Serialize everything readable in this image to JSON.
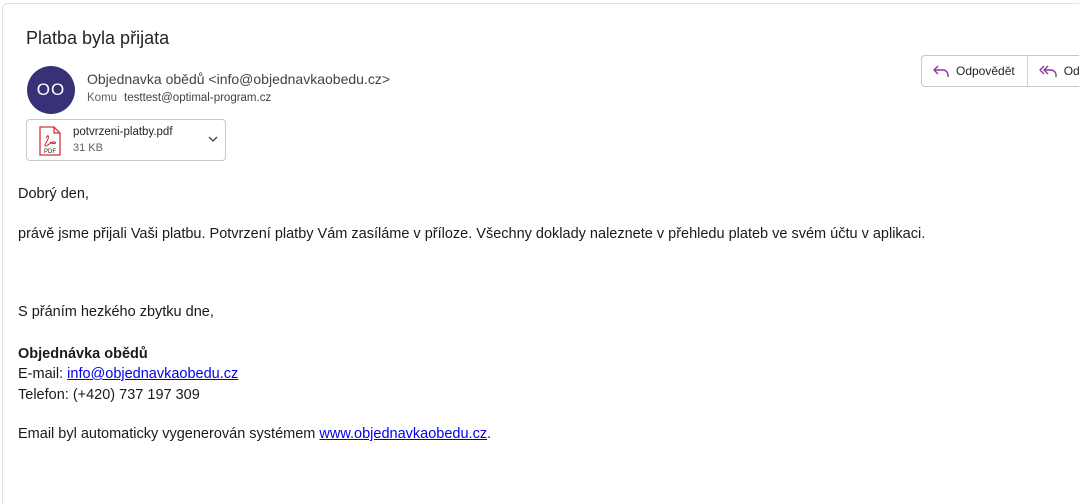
{
  "email": {
    "subject": "Platba byla přijata",
    "avatar_initials": "OO",
    "sender": "Objednavka obědů <info@objednavkaobedu.cz>",
    "to_label": "Komu",
    "to_address": "testtest@optimal-program.cz"
  },
  "actions": {
    "reply": "Odpovědět",
    "reply_all": "Od"
  },
  "attachment": {
    "icon_label": "PDF",
    "filename": "potvrzeni-platby.pdf",
    "size": "31 KB"
  },
  "body": {
    "greeting": "Dobrý den,",
    "message": "právě jsme přijali Vaši platbu. Potvrzení platby Vám zasíláme v příloze. Všechny doklady naleznete v přehledu plateb ve svém účtu v aplikaci.",
    "closing": "S přáním hezkého zbytku dne,",
    "signature_name": "Objednávka obědů",
    "email_label": "E-mail: ",
    "email_link": "info@objednavkaobedu.cz",
    "phone": "Telefon: (+420) 737 197 309",
    "footer_text": "Email byl automaticky vygenerován systémem ",
    "footer_link": "www.objednavkaobedu.cz",
    "footer_end": "."
  },
  "colors": {
    "avatar_bg": "#373277",
    "accent_purple": "#8a3a9e",
    "link": "#0000ee",
    "pdf_red": "#d13438"
  }
}
